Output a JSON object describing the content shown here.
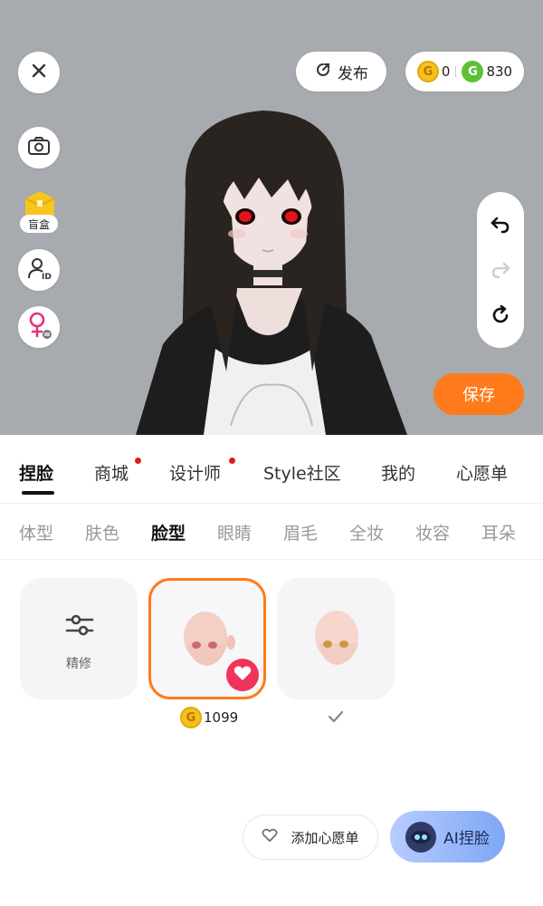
{
  "topbar": {
    "close_icon": "close-icon",
    "publish_label": "发布",
    "gold_coin_count": "0",
    "green_coin_count": "830"
  },
  "left_tools": {
    "camera_icon": "camera-icon",
    "blindbox_label": "盲盒",
    "profile_id_icon": "profile-id-icon",
    "gender_icon": "female-swap-icon"
  },
  "right_tools": {
    "undo_icon": "undo-icon",
    "redo_icon": "redo-icon",
    "reset_icon": "reset-icon"
  },
  "save_label": "保存",
  "main_tabs": [
    {
      "label": "捏脸",
      "active": true,
      "dot": false
    },
    {
      "label": "商城",
      "active": false,
      "dot": true
    },
    {
      "label": "设计师",
      "active": false,
      "dot": true
    },
    {
      "label": "Style社区",
      "active": false,
      "dot": false
    },
    {
      "label": "我的",
      "active": false,
      "dot": false
    },
    {
      "label": "心愿单",
      "active": false,
      "dot": false
    }
  ],
  "sub_tabs": [
    {
      "label": "体型",
      "active": false
    },
    {
      "label": "肤色",
      "active": false
    },
    {
      "label": "脸型",
      "active": true
    },
    {
      "label": "眼睛",
      "active": false
    },
    {
      "label": "眉毛",
      "active": false
    },
    {
      "label": "全妆",
      "active": false
    },
    {
      "label": "妆容",
      "active": false
    },
    {
      "label": "耳朵",
      "active": false
    }
  ],
  "items": [
    {
      "label": "精修",
      "type": "refine"
    },
    {
      "price": "1099",
      "selected": true,
      "favorited": true
    },
    {
      "owned": true
    }
  ],
  "bottom": {
    "wishlist_label": "添加心愿单",
    "ai_label": "AI捏脸"
  },
  "colors": {
    "accent": "#ff7a1a",
    "stage_bg": "#a7aaae",
    "badge_red": "#e21c1c",
    "favorite": "#f0335a"
  }
}
